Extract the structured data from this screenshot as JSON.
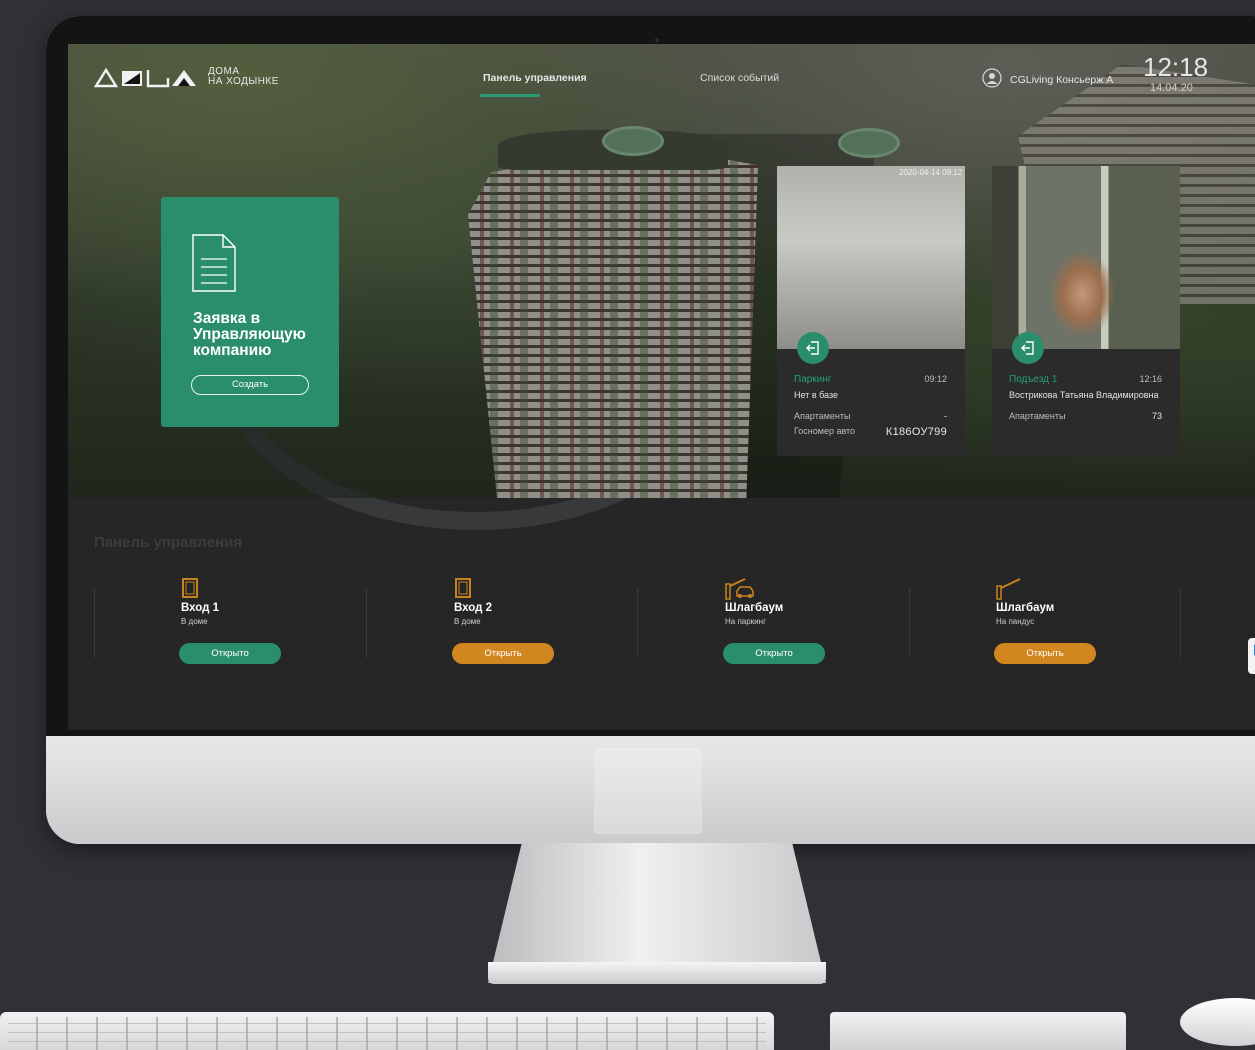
{
  "header": {
    "logo_line1": "ДОМА",
    "logo_line2": "НА ХОДЫНКЕ",
    "nav": [
      "Панель управления",
      "Список событий"
    ],
    "user_name": "CGLiving Консьерж А",
    "time": "12:18",
    "date": "14.04.20"
  },
  "request_card": {
    "title": "Заявка в Управляющую компанию",
    "button": "Создать"
  },
  "cameras": [
    {
      "stamp": "2020-04-14 09:12",
      "name": "Паркинг",
      "time": "09:12",
      "status": "Нет в базе",
      "apartment_label": "Апартаменты",
      "apartment_value": "-",
      "plate_label": "Госномер авто",
      "plate_value": "К186ОУ799"
    },
    {
      "name": "Подъезд 1",
      "time": "12:16",
      "status": "Вострикова Татьяна Владимировна",
      "apartment_label": "Апартаменты",
      "apartment_value": "73"
    }
  ],
  "control_panel": {
    "title": "Панель управления",
    "items": [
      {
        "name": "Вход 1",
        "sub": "В доме",
        "button": "Открыто",
        "state": "green"
      },
      {
        "name": "Вход 2",
        "sub": "В доме",
        "button": "Открыть",
        "state": "orange"
      },
      {
        "name": "Шлагбаум",
        "sub": "На паркинг",
        "button": "Открыто",
        "state": "green"
      },
      {
        "name": "Шлагбаум",
        "sub": "На пандус",
        "button": "Открыть",
        "state": "orange"
      }
    ]
  },
  "colors": {
    "accent_green": "#2a8e6c",
    "accent_orange": "#d1861f",
    "icon_orange": "#c8831e",
    "panel_bg": "#262626"
  },
  "icons": [
    "door-icon",
    "barrier-car-icon",
    "barrier-icon",
    "entry-arrow-icon",
    "document-icon",
    "user-icon"
  ]
}
